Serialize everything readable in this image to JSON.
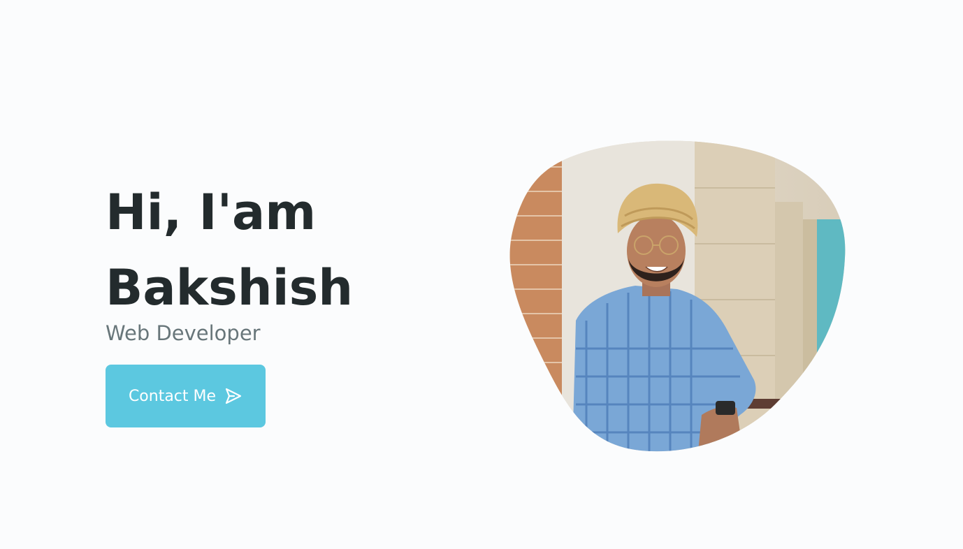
{
  "hero": {
    "greeting": "Hi, I'am",
    "name": "Bakshish",
    "role": "Web Developer",
    "contact_label": "Contact Me",
    "contact_icon": "send-icon"
  },
  "profile_photo": {
    "description_icon": "portrait"
  },
  "colors": {
    "background": "#fbfcfd",
    "heading": "#232b2d",
    "subtitle": "#68767a",
    "accent": "#5cc8e0"
  }
}
